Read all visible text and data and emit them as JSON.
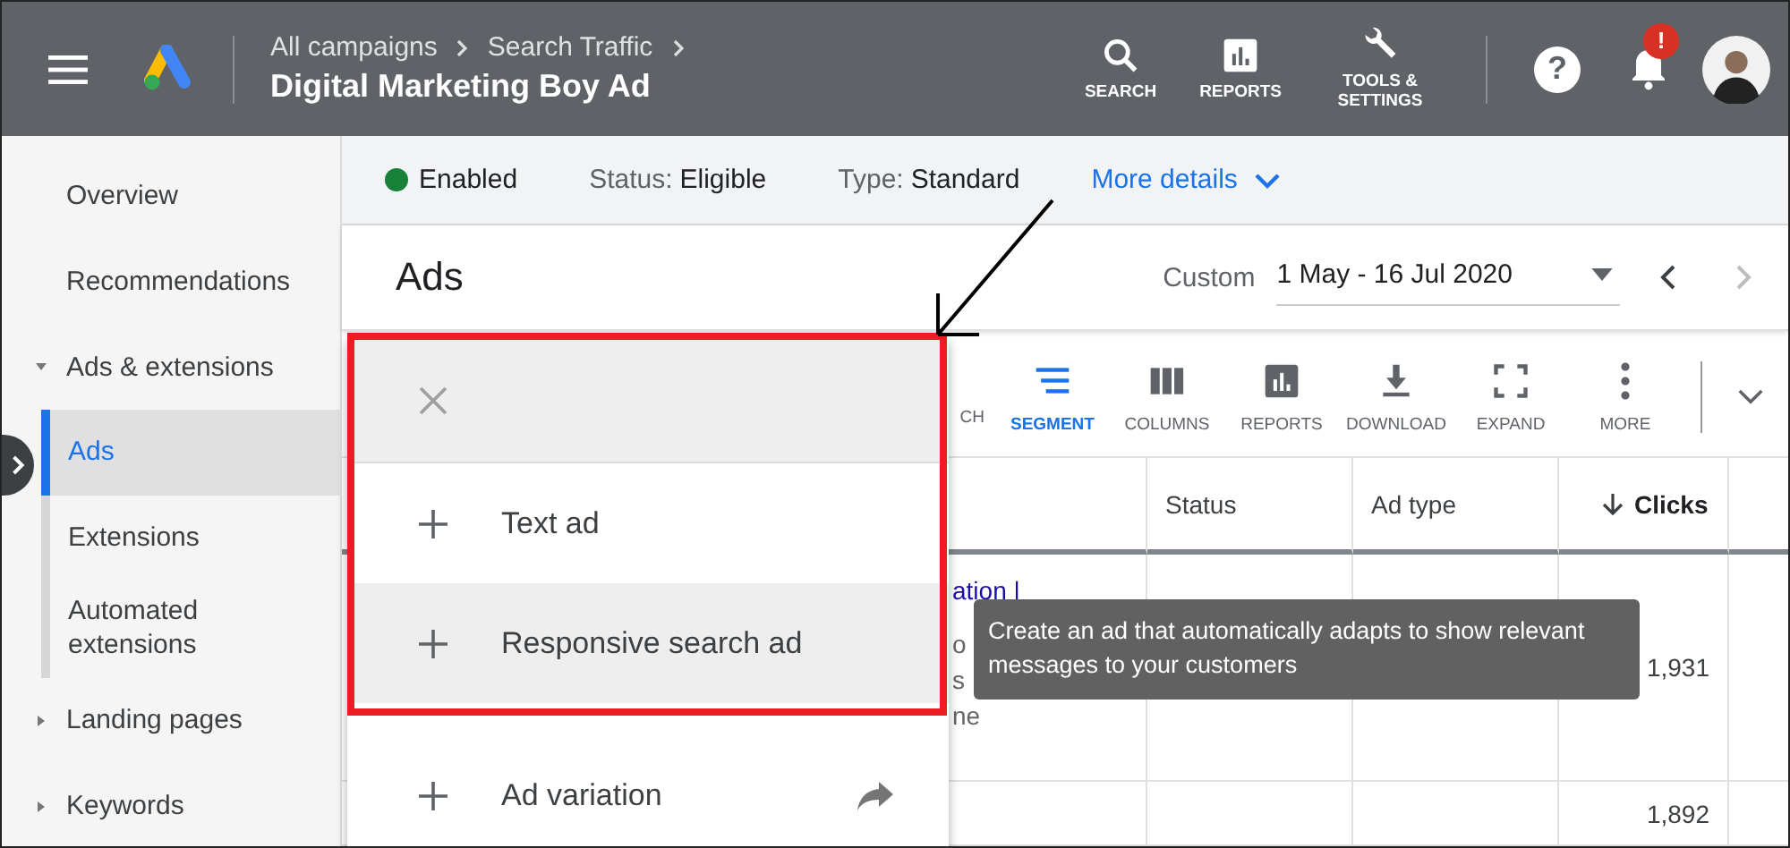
{
  "topbar": {
    "breadcrumbs": [
      "All campaigns",
      "Search Traffic"
    ],
    "title": "Digital Marketing Boy Ad",
    "actions": [
      {
        "kind": "search",
        "label": "SEARCH"
      },
      {
        "kind": "reports",
        "label": "REPORTS"
      },
      {
        "kind": "tools",
        "label": "TOOLS & SETTINGS"
      }
    ],
    "alert": "!",
    "help": "?"
  },
  "sidebar": {
    "items": [
      {
        "kind": "link",
        "label": "Overview",
        "selected": false
      },
      {
        "kind": "link",
        "label": "Recommendations",
        "selected": false
      },
      {
        "kind": "group",
        "label": "Ads & extensions",
        "expanded": true,
        "children": [
          {
            "label": "Ads",
            "selected": true
          },
          {
            "label": "Extensions",
            "selected": false
          },
          {
            "label": "Automated extensions",
            "selected": false
          }
        ]
      },
      {
        "kind": "group",
        "label": "Landing pages",
        "expanded": false
      },
      {
        "kind": "group",
        "label": "Keywords",
        "expanded": false
      }
    ]
  },
  "status_strip": {
    "state": "Enabled",
    "enabled": true,
    "status_label": "Status:",
    "status": "Eligible",
    "type_label": "Type:",
    "type": "Standard",
    "more": "More details"
  },
  "header": {
    "title": "Ads",
    "range_label": "Custom",
    "range": "1 May - 16 Jul 2020"
  },
  "toolbar": [
    {
      "kind": "cut",
      "label": "CH",
      "selected": false
    },
    {
      "kind": "segment",
      "label": "SEGMENT",
      "selected": true
    },
    {
      "kind": "columns",
      "label": "COLUMNS",
      "selected": false
    },
    {
      "kind": "reports",
      "label": "REPORTS",
      "selected": false
    },
    {
      "kind": "download",
      "label": "DOWNLOAD",
      "selected": false
    },
    {
      "kind": "expand",
      "label": "EXPAND",
      "selected": false
    },
    {
      "kind": "more",
      "label": "MORE",
      "selected": false
    }
  ],
  "table": {
    "columns": [
      {
        "label": "Status",
        "sorted": false
      },
      {
        "label": "Ad type",
        "sorted": false
      },
      {
        "label": "Clicks",
        "sorted": true
      }
    ],
    "rows": [
      {
        "link": "ation |",
        "fragments": [
          "o",
          "s",
          "ne"
        ],
        "clicks": "1,931"
      },
      {
        "clicks": "1,892"
      }
    ]
  },
  "menu": {
    "items": [
      {
        "kind": "plain",
        "label": "Text ad",
        "selected": false
      },
      {
        "kind": "plain",
        "label": "Responsive search ad",
        "selected": true
      },
      {
        "kind": "external",
        "label": "Ad variation",
        "selected": false
      }
    ]
  },
  "tooltip": "Create an ad that automatically adapts to show relevant messages to your customers"
}
